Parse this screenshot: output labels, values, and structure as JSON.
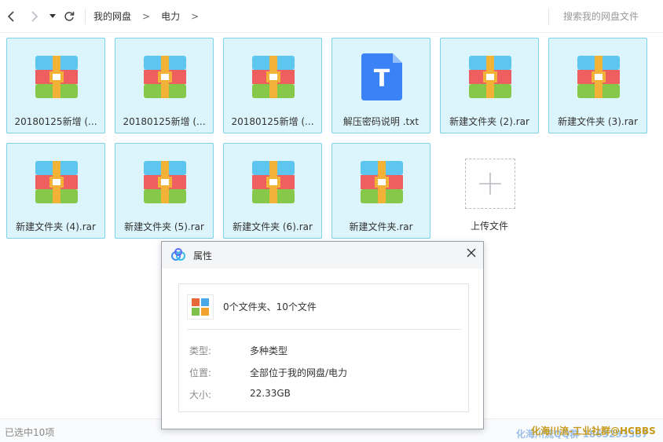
{
  "toolbar": {
    "breadcrumb": [
      "我的网盘",
      "电力"
    ],
    "crumb_sep": ">",
    "search_placeholder": "搜索我的网盘文件"
  },
  "files": [
    {
      "name": "20180125新增 (...",
      "type": "rar"
    },
    {
      "name": "20180125新增 (...",
      "type": "rar"
    },
    {
      "name": "20180125新增 (...",
      "type": "rar"
    },
    {
      "name": "解压密码说明 .txt",
      "type": "txt"
    },
    {
      "name": "新建文件夹 (2).rar",
      "type": "rar"
    },
    {
      "name": "新建文件夹 (3).rar",
      "type": "rar"
    },
    {
      "name": "新建文件夹 (4).rar",
      "type": "rar"
    },
    {
      "name": "新建文件夹 (5).rar",
      "type": "rar"
    },
    {
      "name": "新建文件夹 (6).rar",
      "type": "rar"
    },
    {
      "name": "新建文件夹.rar",
      "type": "rar"
    }
  ],
  "upload": {
    "label": "上传文件"
  },
  "txt_icon_letter": "T",
  "status": {
    "selected": "已选中10项"
  },
  "watermark": {
    "text": "化海川流-工业社群@HCBBS",
    "text2": "化海川流QQ群 1863293387"
  },
  "dialog": {
    "title": "属性",
    "summary": "0个文件夹、10个文件",
    "rows": [
      {
        "key": "类型:",
        "value": "多种类型"
      },
      {
        "key": "位置:",
        "value": "全部位于我的网盘/电力"
      },
      {
        "key": "大小:",
        "value": "22.33GB"
      }
    ]
  },
  "colors": {
    "tile_bg": "#dcf4fb",
    "tile_border": "#7dd3e8",
    "txt_icon": "#3b82f6"
  }
}
